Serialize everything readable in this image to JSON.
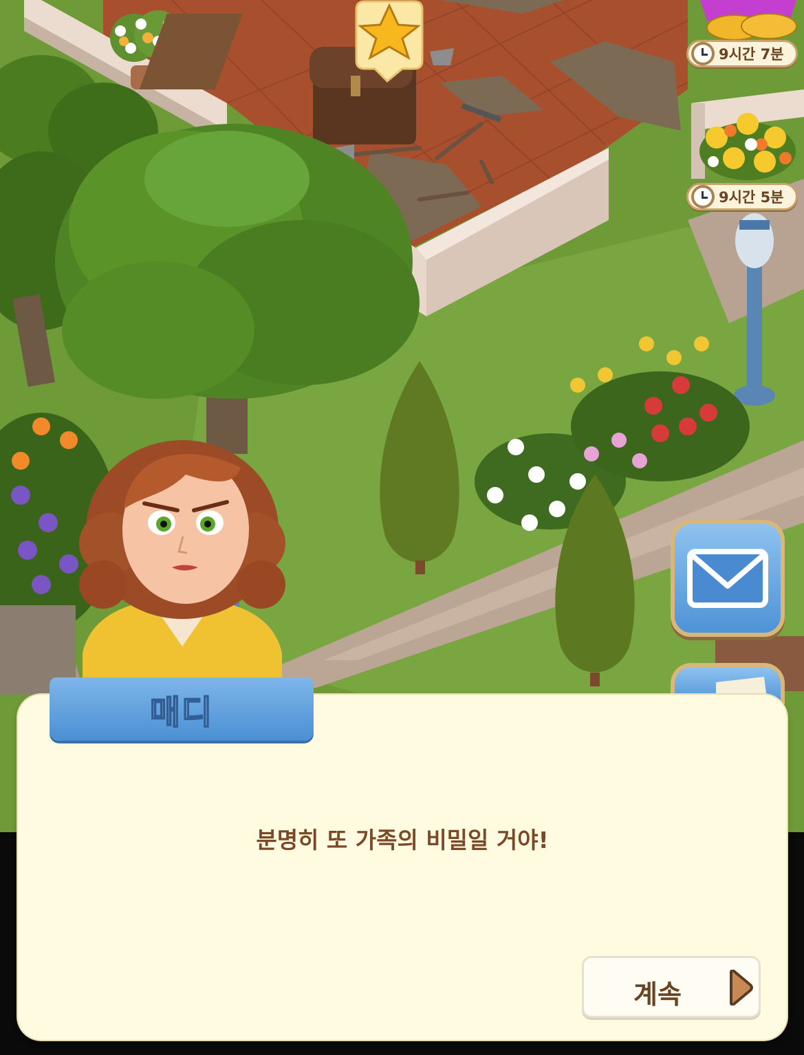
{
  "quest_icon": "star-icon",
  "timers": [
    {
      "icon": "clock-icon",
      "text": "9시간 7분"
    },
    {
      "icon": "clock-icon",
      "text": "9시간 5분"
    }
  ],
  "side_buttons": [
    {
      "icon": "mail-icon"
    },
    {
      "icon": "note-icon"
    }
  ],
  "dialog": {
    "speaker": "매디",
    "message": "분명히 또 가족의 비밀일 거야!",
    "continue_label": "계속",
    "continue_icon": "play-icon"
  },
  "colors": {
    "dialog_bg": "#fefbe1",
    "name_tab": "#5b9ee0",
    "text": "#7a4a28"
  }
}
